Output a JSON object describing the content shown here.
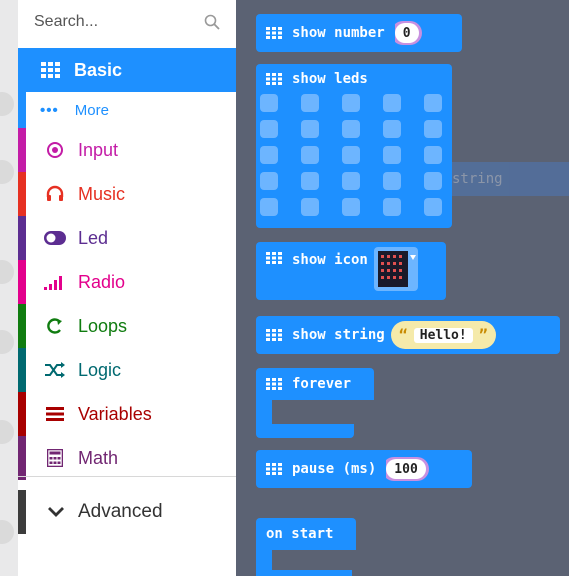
{
  "search": {
    "placeholder": "Search..."
  },
  "categories": [
    {
      "label": "Basic",
      "color": "#1e90ff",
      "icon": "grid-icon"
    },
    {
      "label": "More",
      "color": "#1e90ff",
      "icon": "more-dots-icon"
    },
    {
      "label": "Input",
      "color": "#c31ca6",
      "icon": "target-icon"
    },
    {
      "label": "Music",
      "color": "#e63022",
      "icon": "headphones-icon"
    },
    {
      "label": "Led",
      "color": "#5c2d91",
      "icon": "toggle-icon"
    },
    {
      "label": "Radio",
      "color": "#e3008c",
      "icon": "signal-bars-icon"
    },
    {
      "label": "Loops",
      "color": "#107c10",
      "icon": "loop-icon"
    },
    {
      "label": "Logic",
      "color": "#006970",
      "icon": "shuffle-icon"
    },
    {
      "label": "Variables",
      "color": "#a80000",
      "icon": "list-lines-icon"
    },
    {
      "label": "Math",
      "color": "#712672",
      "icon": "calculator-icon"
    }
  ],
  "advanced": {
    "label": "Advanced",
    "icon": "chevron-down-icon"
  },
  "blocks": {
    "show_number": {
      "label": "show number",
      "value": "0"
    },
    "show_leds": {
      "label": "show leds"
    },
    "show_icon": {
      "label": "show icon"
    },
    "show_string": {
      "label": "show string",
      "open_quote": "“",
      "value": "Hello!",
      "close_quote": "”"
    },
    "forever": {
      "label": "forever"
    },
    "pause": {
      "label": "pause (ms)",
      "value": "100"
    },
    "on_start": {
      "label": "on start"
    },
    "ghost": {
      "label": "string"
    }
  },
  "colors": {
    "accent": "#1e90ff",
    "workspace": "#5b6273",
    "string_field": "#f5eaaa"
  }
}
